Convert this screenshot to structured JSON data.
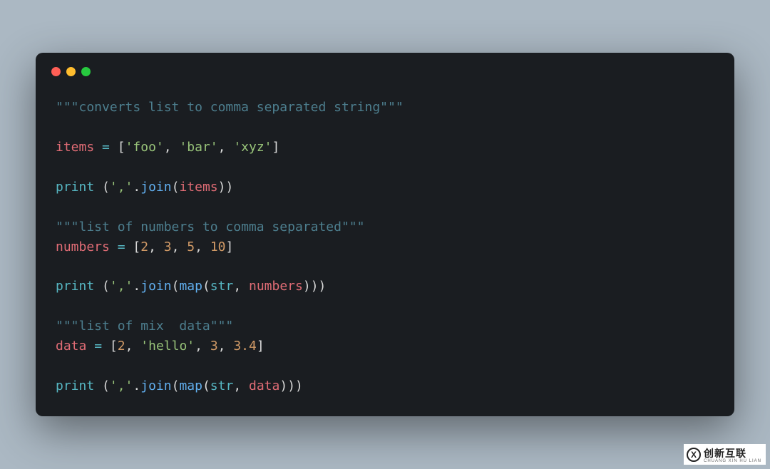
{
  "watermark": {
    "brand": "创新互联",
    "sub": "CHUANG XIN HU LIAN",
    "glyph": "X"
  },
  "code": {
    "lines": [
      {
        "type": "doc",
        "content": "\"\"\"converts list to comma separated string\"\"\""
      },
      {
        "type": "blank"
      },
      {
        "type": "assign_strlist",
        "var": "items",
        "items": [
          "'foo'",
          "'bar'",
          "'xyz'"
        ]
      },
      {
        "type": "blank"
      },
      {
        "type": "print_join_simple",
        "sep": "','",
        "arg": "items"
      },
      {
        "type": "blank"
      },
      {
        "type": "doc",
        "content": "\"\"\"list of numbers to comma separated\"\"\""
      },
      {
        "type": "assign_numlist",
        "var": "numbers",
        "items": [
          "2",
          "3",
          "5",
          "10"
        ]
      },
      {
        "type": "blank"
      },
      {
        "type": "print_join_map",
        "sep": "','",
        "fn": "str",
        "arg": "numbers"
      },
      {
        "type": "blank"
      },
      {
        "type": "doc",
        "content": "\"\"\"list of mix  data\"\"\""
      },
      {
        "type": "assign_mixlist",
        "var": "data",
        "items": [
          {
            "k": "num",
            "v": "2"
          },
          {
            "k": "str",
            "v": "'hello'"
          },
          {
            "k": "num",
            "v": "3"
          },
          {
            "k": "num",
            "v": "3.4"
          }
        ]
      },
      {
        "type": "blank"
      },
      {
        "type": "print_join_map",
        "sep": "','",
        "fn": "str",
        "arg": "data"
      }
    ]
  }
}
